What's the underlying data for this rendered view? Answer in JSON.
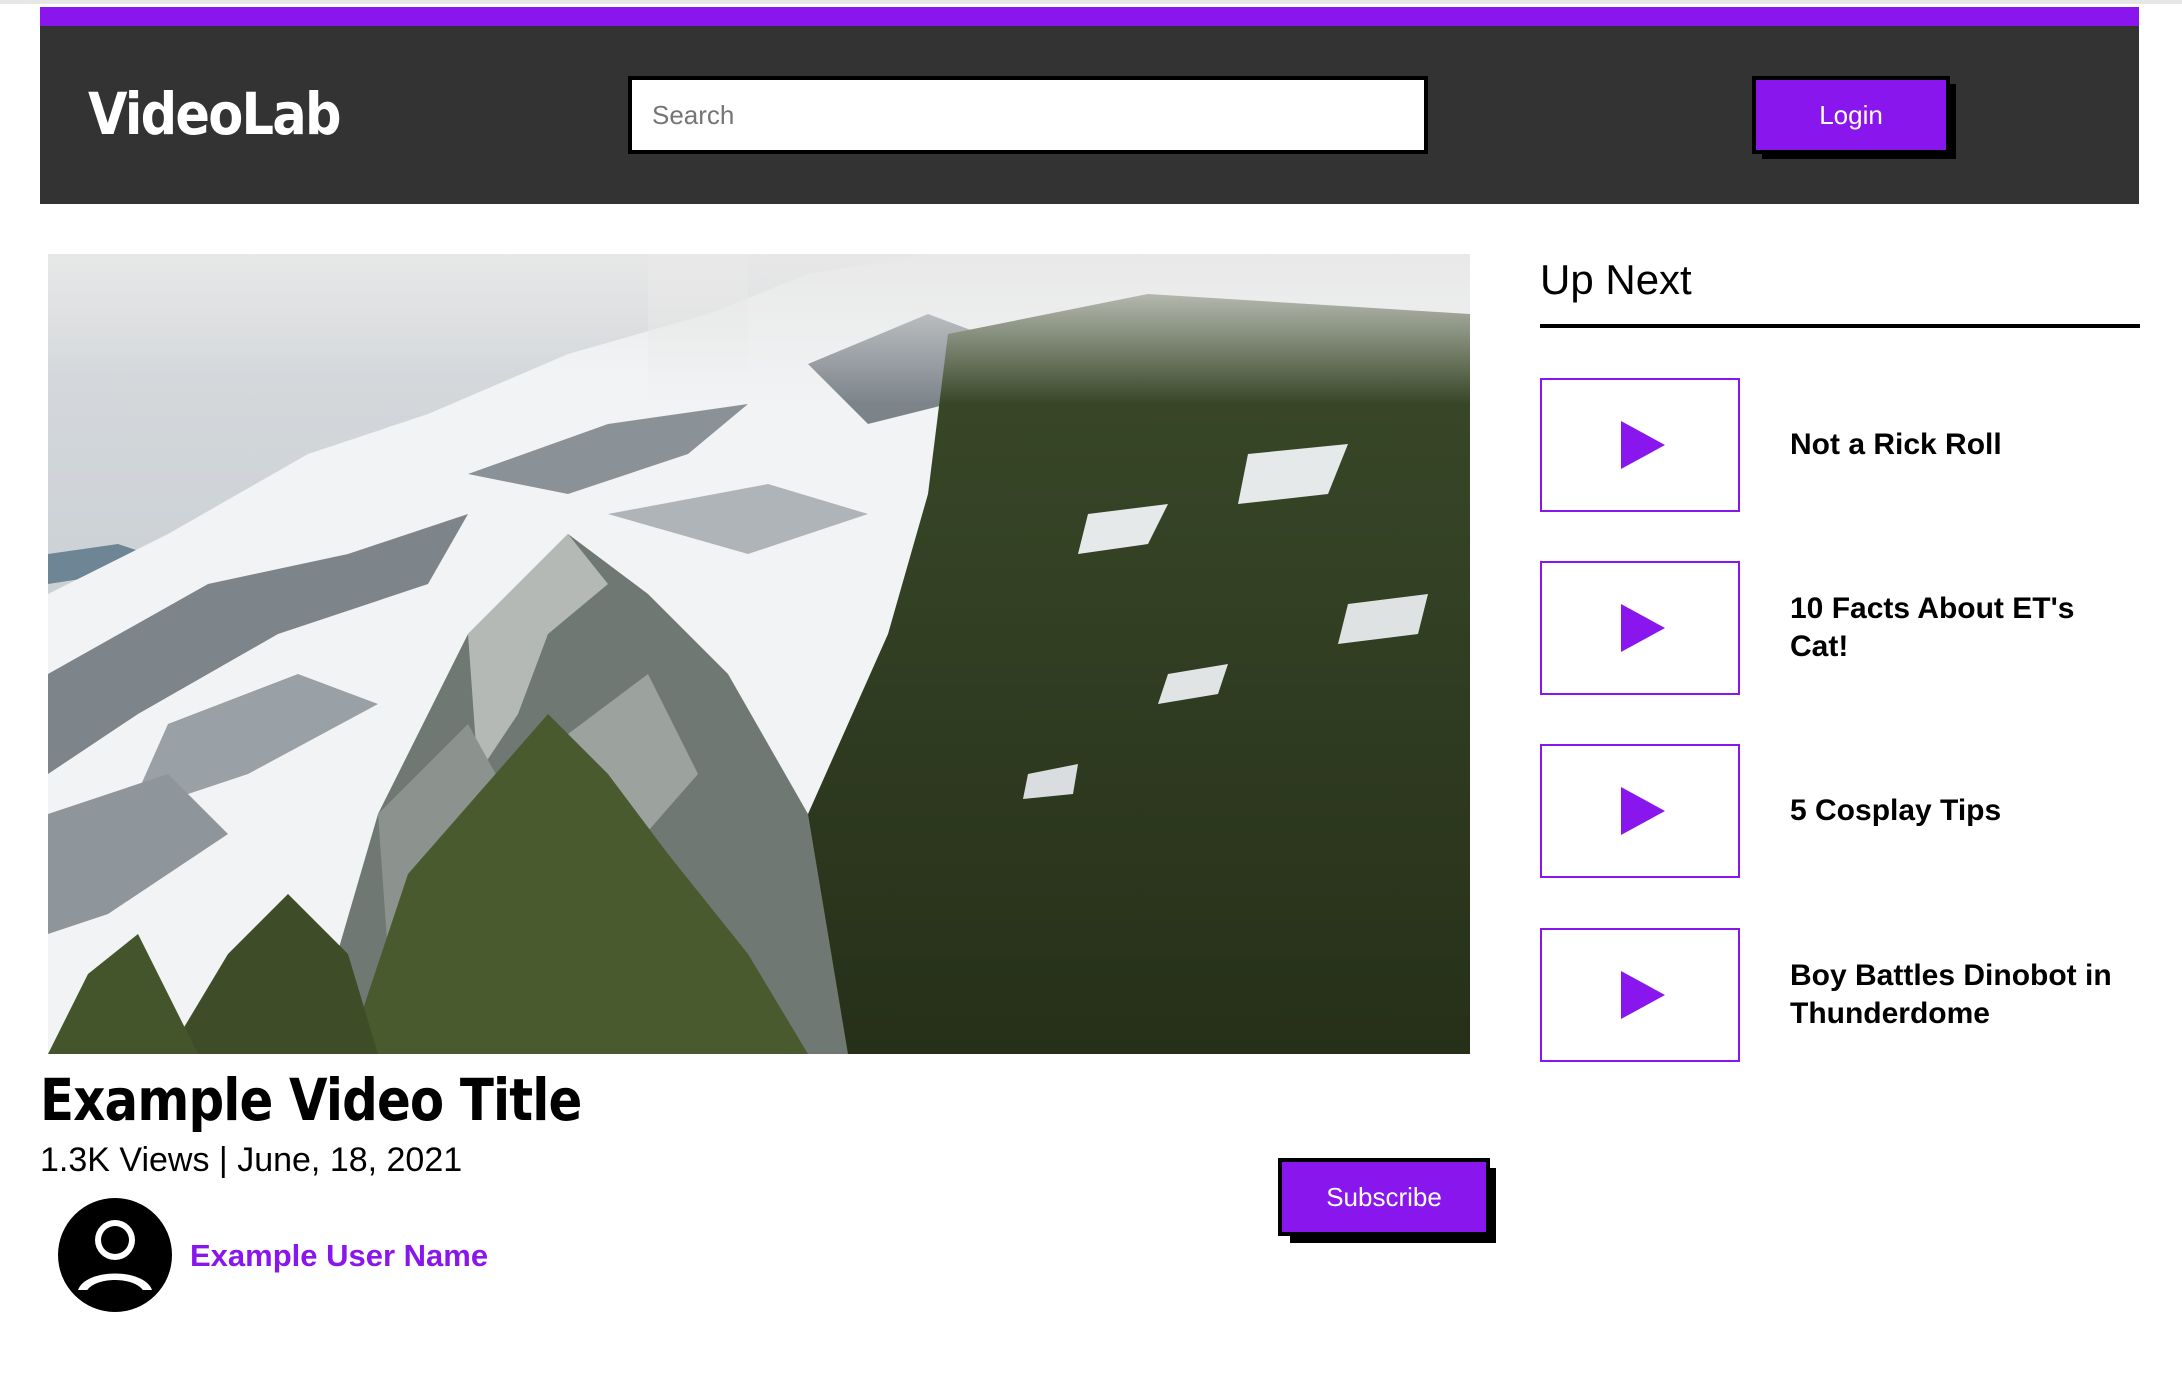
{
  "header": {
    "logo": "VideoLab",
    "search_placeholder": "Search",
    "login_label": "Login"
  },
  "colors": {
    "accent": "#8a16ee",
    "header_bg": "#333333",
    "text": "#000000"
  },
  "video": {
    "title": "Example Video Title",
    "meta": "1.3K Views | June, 18, 2021",
    "user_name": "Example User Name",
    "subscribe_label": "Subscribe"
  },
  "up_next": {
    "heading": "Up Next",
    "items": [
      {
        "title": "Not a Rick Roll",
        "icon": "play-icon"
      },
      {
        "title": "10 Facts About ET's Cat!",
        "icon": "play-icon"
      },
      {
        "title": "5 Cosplay Tips",
        "icon": "play-icon"
      },
      {
        "title": "Boy Battles Dinobot in Thunderdome",
        "icon": "play-icon"
      }
    ]
  }
}
